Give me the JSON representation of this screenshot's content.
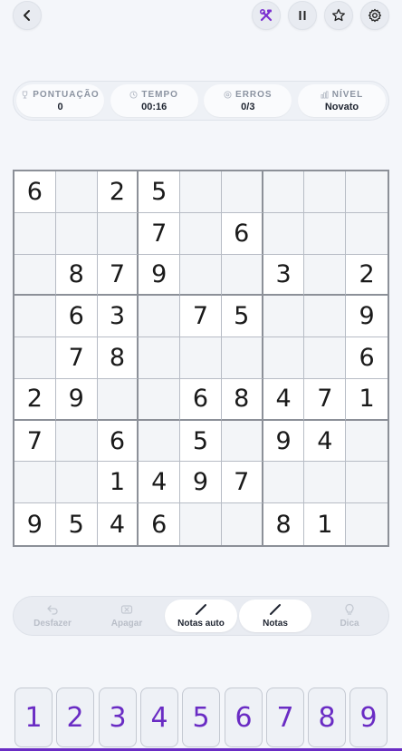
{
  "stats": [
    {
      "label": "PONTUAÇÃO",
      "value": "0",
      "icon": "trophy-icon"
    },
    {
      "label": "TEMPO",
      "value": "00:16",
      "icon": "clock-icon"
    },
    {
      "label": "ERROS",
      "value": "0/3",
      "icon": "target-icon"
    },
    {
      "label": "NÍVEL",
      "value": "Novato",
      "icon": "bars-icon"
    }
  ],
  "grid": [
    [
      "6",
      "",
      "2",
      "5",
      "",
      "",
      "",
      "",
      ""
    ],
    [
      "",
      "",
      "",
      "7",
      "",
      "6",
      "",
      "",
      ""
    ],
    [
      "",
      "8",
      "7",
      "9",
      "",
      "",
      "3",
      "",
      "2"
    ],
    [
      "",
      "6",
      "3",
      "",
      "7",
      "5",
      "",
      "",
      "9"
    ],
    [
      "",
      "7",
      "8",
      "",
      "",
      "",
      "",
      "",
      "6"
    ],
    [
      "2",
      "9",
      "",
      "",
      "6",
      "8",
      "4",
      "7",
      "1"
    ],
    [
      "7",
      "",
      "6",
      "",
      "5",
      "",
      "9",
      "4",
      ""
    ],
    [
      "",
      "",
      "1",
      "4",
      "9",
      "7",
      "",
      "",
      ""
    ],
    [
      "9",
      "5",
      "4",
      "6",
      "",
      "",
      "8",
      "1",
      ""
    ]
  ],
  "toolbar": {
    "undo": "Desfazer",
    "erase": "Apagar",
    "auto_notes": "Notas auto",
    "notes": "Notas",
    "hint": "Dica"
  },
  "numpad": [
    "1",
    "2",
    "3",
    "4",
    "5",
    "6",
    "7",
    "8",
    "9"
  ],
  "colors": {
    "accent": "#6a2cc4",
    "tools_icon": "#7b2fd0"
  }
}
